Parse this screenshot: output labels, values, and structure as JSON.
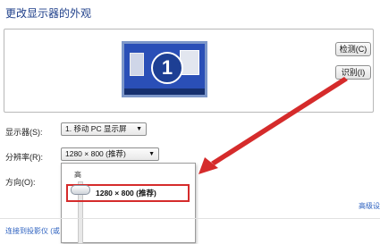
{
  "window": {
    "title": "更改显示器的外观"
  },
  "preview": {
    "monitor_number": "1"
  },
  "buttons": {
    "detect": "检测(C)",
    "identify": "识别(I)"
  },
  "display": {
    "label": "显示器(S):",
    "value": "1. 移动 PC 显示屏"
  },
  "resolution": {
    "label": "分辨率(R):",
    "value": "1280 × 800 (推荐)",
    "slider_high_label": "高",
    "selected_option": "1280 × 800 (推荐)"
  },
  "orientation": {
    "label": "方向(O):"
  },
  "links": {
    "advanced": "高级设",
    "projector": "连接到投影仪 (或"
  },
  "colors": {
    "highlight_border": "#d52b2b",
    "monitor_blue": "#2a4fb7",
    "link": "#2a5fbf"
  }
}
